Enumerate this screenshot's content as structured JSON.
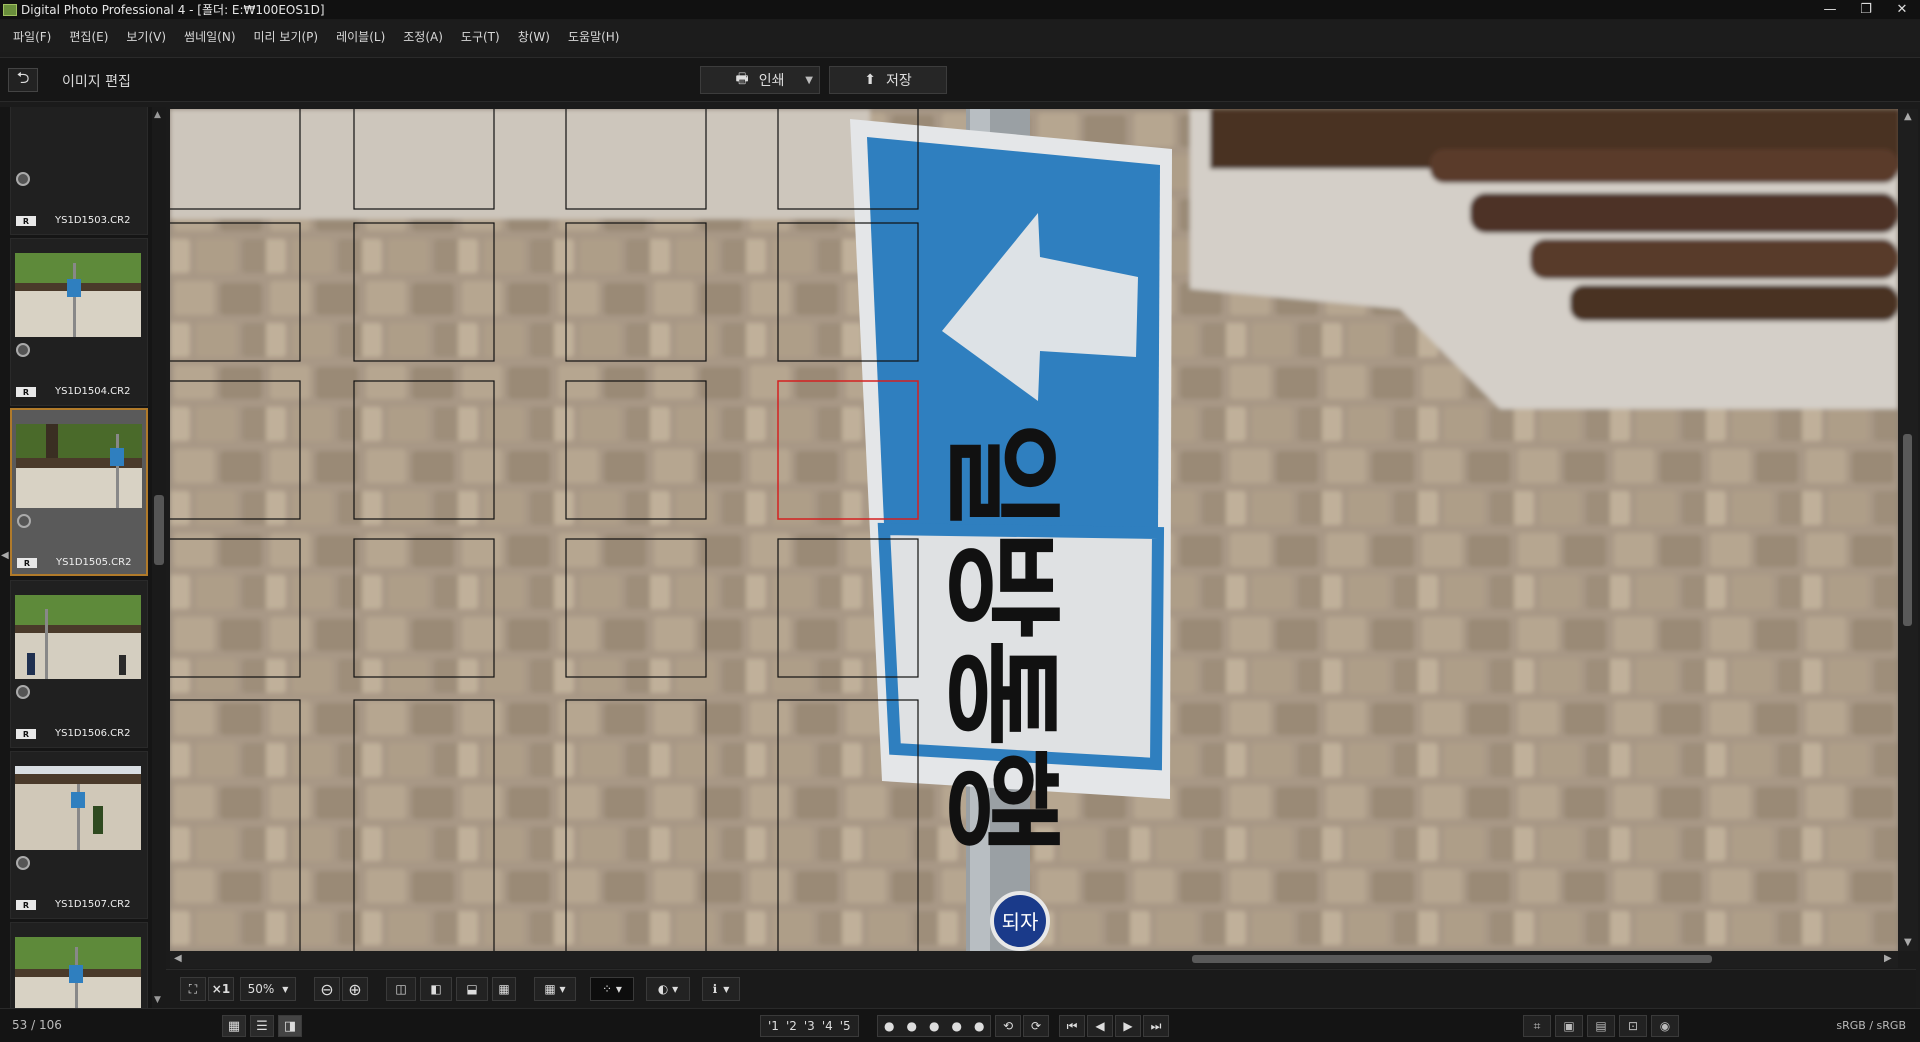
{
  "window": {
    "title": "Digital Photo Professional 4 - [폴더: E:₩100EOS1D]",
    "minimize": "—",
    "maximize": "❐",
    "close": "✕"
  },
  "menu": [
    "파일(F)",
    "편집(E)",
    "보기(V)",
    "썸네일(N)",
    "미리 보기(P)",
    "레이블(L)",
    "조정(A)",
    "도구(T)",
    "창(W)",
    "도움말(H)"
  ],
  "toolbar": {
    "undo_icon": "⮌",
    "mode_title": "이미지 편집",
    "print_label": "인쇄",
    "print_icon": "🖶",
    "save_label": "저장",
    "save_icon": "⬆",
    "dropdown_icon": "▼"
  },
  "filmstrip": {
    "items": [
      {
        "name": "YS1D1503.CR2",
        "raw": "R"
      },
      {
        "name": "YS1D1504.CR2",
        "raw": "R"
      },
      {
        "name": "YS1D1505.CR2",
        "raw": "R",
        "selected": true
      },
      {
        "name": "YS1D1506.CR2",
        "raw": "R"
      },
      {
        "name": "YS1D1507.CR2",
        "raw": "R"
      },
      {
        "name": "",
        "raw": ""
      }
    ],
    "up_arrow": "▲",
    "down_arrow": "▼"
  },
  "viewer": {
    "sign_text": "일방통행",
    "sticker_text": "되자"
  },
  "zoom_bar": {
    "fit_icon": "⛶",
    "x1_label": "×1",
    "zoom_value": "50%",
    "zoom_out_icon": "⊖",
    "zoom_in_icon": "⊕",
    "info_icon": "ℹ"
  },
  "status": {
    "counter": "53 / 106",
    "ratings": [
      "'1",
      "'2",
      "'3",
      "'4",
      "'5"
    ],
    "dots": [
      "●",
      "●",
      "●",
      "●",
      "●"
    ],
    "colorspace": "sRGB / sRGB"
  },
  "colors": {
    "sign_blue": "#2f7fbf",
    "selection_border": "#b07a2a",
    "af_active": "#d42020"
  }
}
